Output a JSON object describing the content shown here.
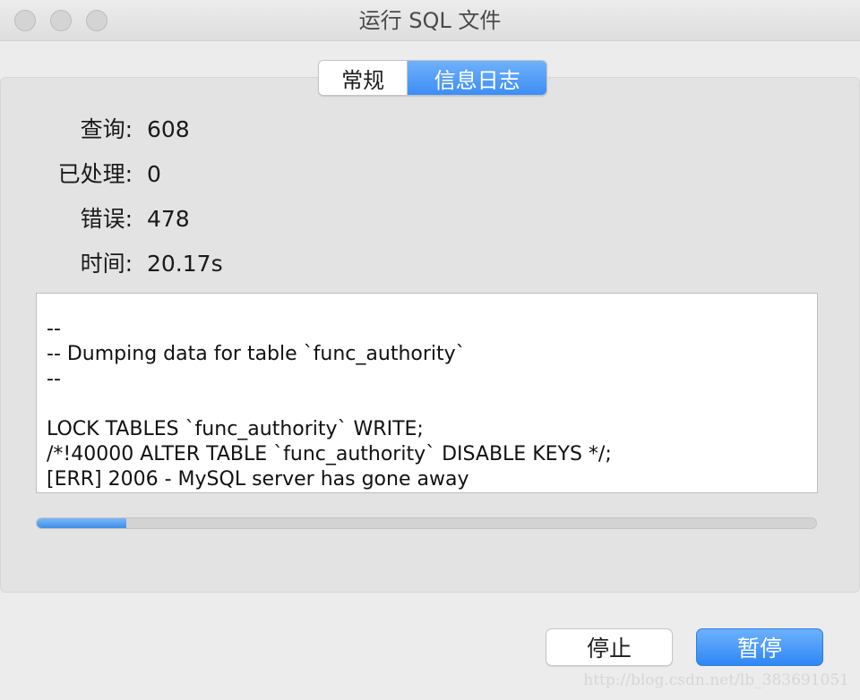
{
  "window": {
    "title": "运行 SQL 文件"
  },
  "tabs": [
    {
      "label": "常规",
      "active": false
    },
    {
      "label": "信息日志",
      "active": true
    }
  ],
  "stats": [
    {
      "label": "查询:",
      "value": "608"
    },
    {
      "label": "已处理:",
      "value": "0"
    },
    {
      "label": "错误:",
      "value": "478"
    },
    {
      "label": "时间:",
      "value": "20.17s"
    }
  ],
  "log": {
    "lines": [
      "--",
      "-- Dumping data for table `func_authority`",
      "--",
      "",
      "LOCK TABLES `func_authority` WRITE;",
      "/*!40000 ALTER TABLE `func_authority` DISABLE KEYS */;",
      "[ERR] 2006 - MySQL server has gone away"
    ]
  },
  "progress": {
    "fraction": 0.115
  },
  "buttons": {
    "stop_label": "停止",
    "pause_label": "暂停"
  },
  "watermark": "http://blog.csdn.net/lb_383691051",
  "colors": {
    "accent": "#3d8ef5",
    "window_bg": "#ececec"
  }
}
